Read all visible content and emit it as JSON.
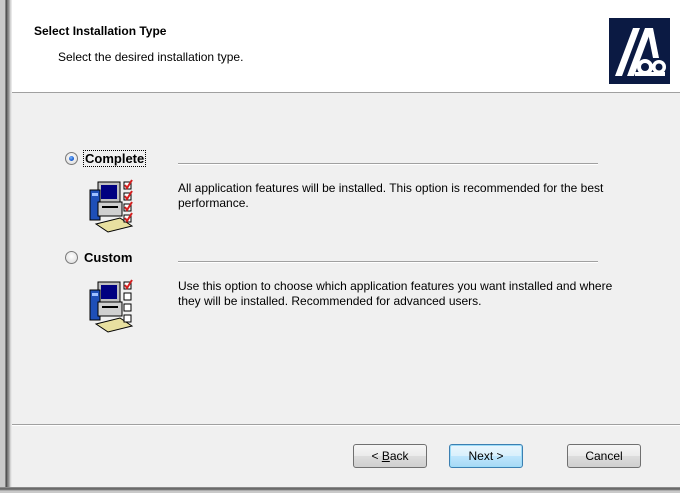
{
  "header": {
    "title": "Select Installation Type",
    "subtitle": "Select the desired installation type."
  },
  "options": [
    {
      "label": "Complete",
      "selected": true,
      "description": "All application features will be installed. This option is recommended for the best performance.",
      "icon": "complete-setup-icon"
    },
    {
      "label": "Custom",
      "selected": false,
      "description": "Use this option to choose which application features you want installed and where they will be installed. Recommended for advanced users.",
      "icon": "custom-setup-icon"
    }
  ],
  "buttons": {
    "back_mnemonic": "B",
    "back_rest": "ack",
    "back_prefix": "< ",
    "next_label": "Next >",
    "cancel_label": "Cancel"
  },
  "logo_icon": "installer-logo-icon",
  "colors": {
    "header_bg": "#ffffff",
    "dialog_bg": "#f0f0f0",
    "logo_bg": "#0b1a43",
    "check_red": "#d42020"
  }
}
